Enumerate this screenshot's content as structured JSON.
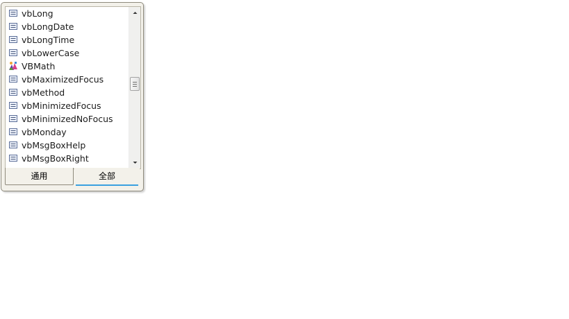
{
  "popup": {
    "items": [
      {
        "label": "vbLong",
        "icon": "constant-icon"
      },
      {
        "label": "vbLongDate",
        "icon": "constant-icon"
      },
      {
        "label": "vbLongTime",
        "icon": "constant-icon"
      },
      {
        "label": "vbLowerCase",
        "icon": "constant-icon"
      },
      {
        "label": "VBMath",
        "icon": "module-icon"
      },
      {
        "label": "vbMaximizedFocus",
        "icon": "constant-icon"
      },
      {
        "label": "vbMethod",
        "icon": "constant-icon"
      },
      {
        "label": "vbMinimizedFocus",
        "icon": "constant-icon"
      },
      {
        "label": "vbMinimizedNoFocus",
        "icon": "constant-icon"
      },
      {
        "label": "vbMonday",
        "icon": "constant-icon"
      },
      {
        "label": "vbMsgBoxHelp",
        "icon": "constant-icon"
      },
      {
        "label": "vbMsgBoxRight",
        "icon": "constant-icon"
      }
    ],
    "tabs": {
      "general": "通用",
      "all": "全部"
    },
    "selected_tab": "all",
    "colors": {
      "tab_accent": "#39a0e0",
      "border": "#8e8a7c"
    }
  }
}
